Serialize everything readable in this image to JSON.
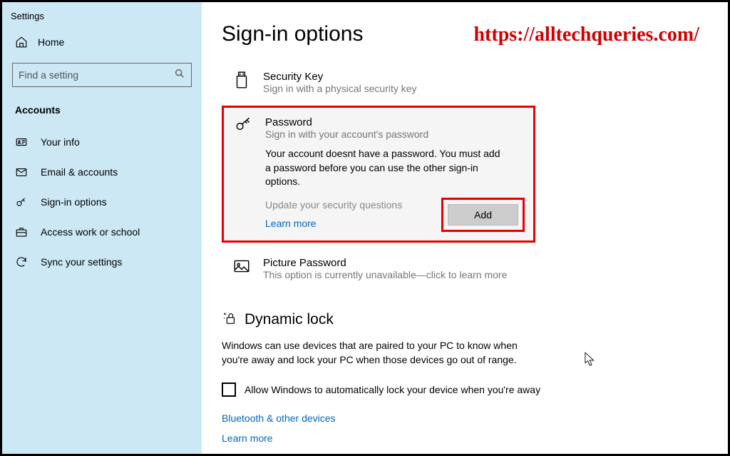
{
  "app_title": "Settings",
  "watermark": "https://alltechqueries.com/",
  "sidebar": {
    "home_label": "Home",
    "search_placeholder": "Find a setting",
    "section_heading": "Accounts",
    "items": [
      {
        "label": "Your info"
      },
      {
        "label": "Email & accounts"
      },
      {
        "label": "Sign-in options"
      },
      {
        "label": "Access work or school"
      },
      {
        "label": "Sync your settings"
      }
    ]
  },
  "main": {
    "title": "Sign-in options",
    "security_key": {
      "title": "Security Key",
      "sub": "Sign in with a physical security key"
    },
    "password": {
      "title": "Password",
      "sub": "Sign in with your account's password",
      "message": "Your account doesnt have a password. You must add a password before you can use the other sign-in options.",
      "update_questions": "Update your security questions",
      "learn_more": "Learn more",
      "add_button": "Add"
    },
    "picture_password": {
      "title": "Picture Password",
      "sub": "This option is currently unavailable—click to learn more"
    },
    "dynamic_lock": {
      "title": "Dynamic lock",
      "description": "Windows can use devices that are paired to your PC to know when you're away and lock your PC when those devices go out of range.",
      "checkbox_label": "Allow Windows to automatically lock your device when you're away"
    },
    "links": {
      "bluetooth": "Bluetooth & other devices",
      "learn_more": "Learn more"
    }
  }
}
